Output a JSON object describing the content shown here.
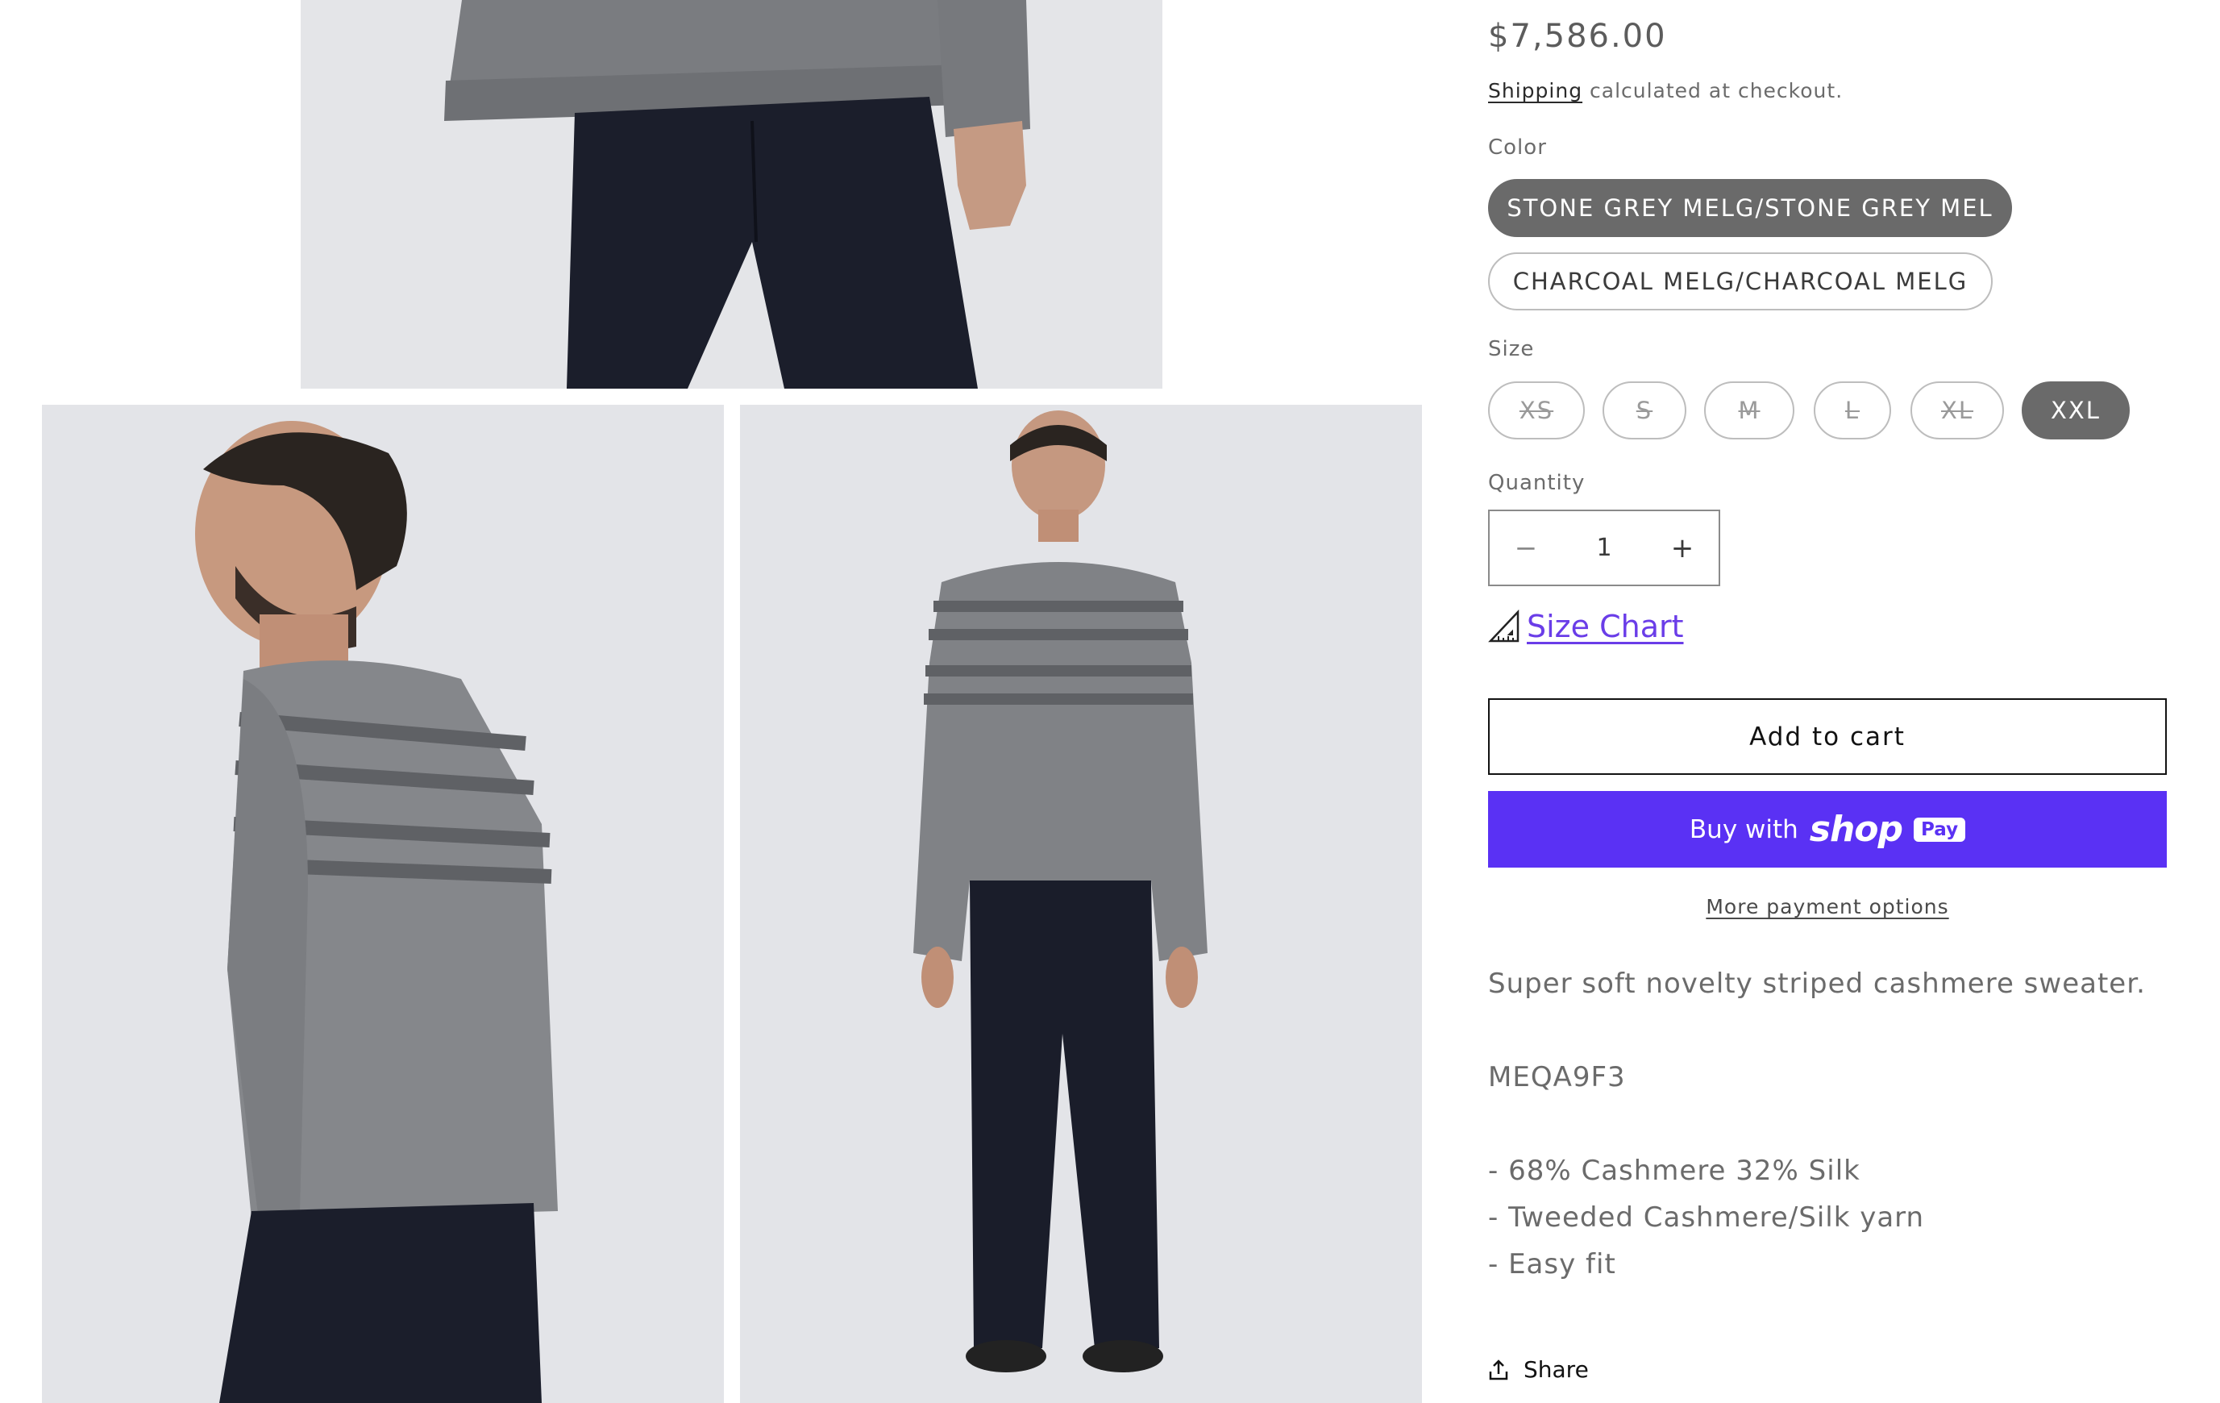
{
  "product": {
    "price": "$7,586.00",
    "shipping_link": "Shipping",
    "shipping_text": " calculated at checkout."
  },
  "color": {
    "label": "Color",
    "options": [
      {
        "label": "STONE GREY MELG/STONE GREY MEL",
        "selected": true
      },
      {
        "label": "CHARCOAL MELG/CHARCOAL MELG",
        "selected": false
      }
    ]
  },
  "size": {
    "label": "Size",
    "options": [
      {
        "label": "XS",
        "available": false
      },
      {
        "label": "S",
        "available": false
      },
      {
        "label": "M",
        "available": false
      },
      {
        "label": "L",
        "available": false
      },
      {
        "label": "XL",
        "available": false
      },
      {
        "label": "XXL",
        "available": true,
        "selected": true
      }
    ]
  },
  "quantity": {
    "label": "Quantity",
    "value": "1",
    "minus": "−",
    "plus": "+"
  },
  "size_chart": {
    "label": "Size Chart",
    "icon": "ruler-icon"
  },
  "actions": {
    "add_to_cart": "Add to cart",
    "buy_with": "Buy with",
    "shop_brand": "shop",
    "pay_badge": "Pay",
    "more_payment": "More payment options"
  },
  "description": {
    "summary": "Super soft novelty striped cashmere sweater.",
    "sku": "MEQA9F3",
    "bullets": [
      "- 68% Cashmere 32% Silk",
      "- Tweeded Cashmere/Silk yarn",
      "- Easy fit"
    ]
  },
  "share": {
    "label": "Share",
    "icon": "share-icon"
  },
  "colors": {
    "accent_purple": "#5a31f4",
    "link_purple": "#6a3de8",
    "selected_pill": "#6a6a6a",
    "text_muted": "#6b6b6b"
  }
}
